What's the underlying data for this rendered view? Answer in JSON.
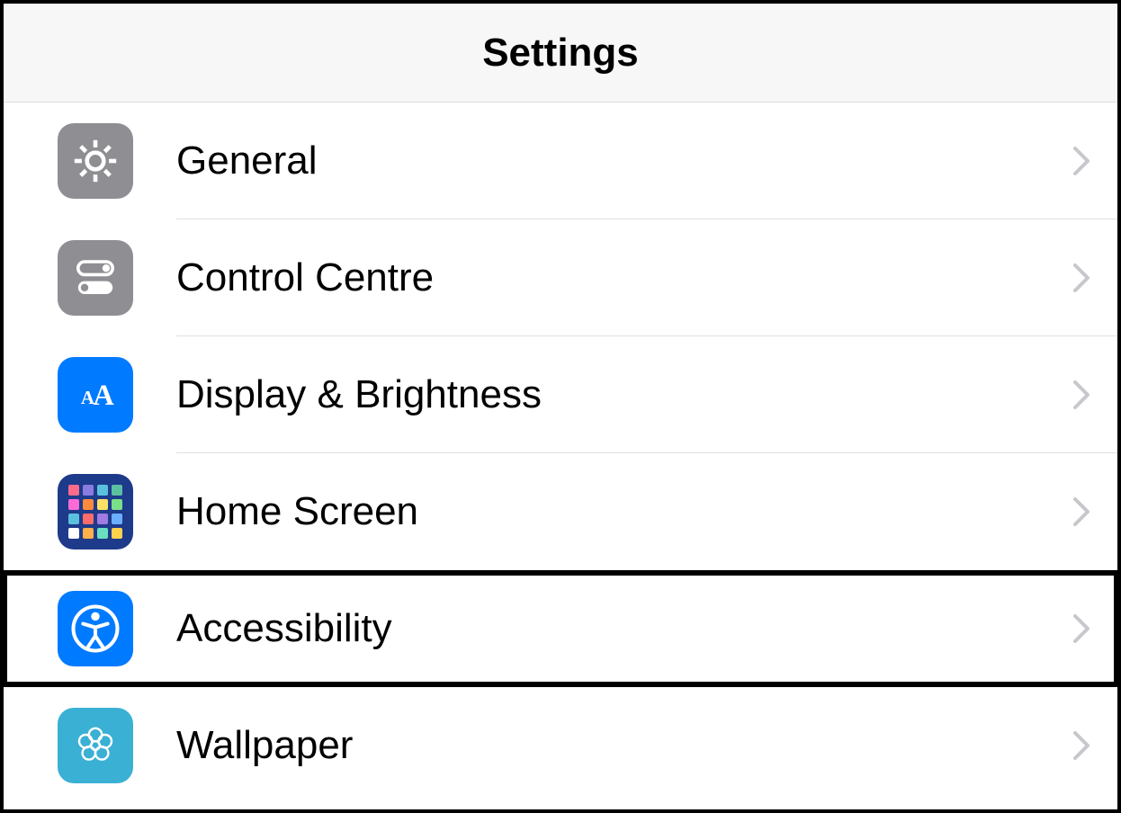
{
  "header": {
    "title": "Settings"
  },
  "items": [
    {
      "label": "General",
      "icon": "gear-icon",
      "highlighted": false
    },
    {
      "label": "Control Centre",
      "icon": "toggles-icon",
      "highlighted": false
    },
    {
      "label": "Display & Brightness",
      "icon": "text-size-icon",
      "highlighted": false
    },
    {
      "label": "Home Screen",
      "icon": "home-grid-icon",
      "highlighted": false
    },
    {
      "label": "Accessibility",
      "icon": "accessibility-icon",
      "highlighted": true
    },
    {
      "label": "Wallpaper",
      "icon": "flower-icon",
      "highlighted": false
    }
  ]
}
